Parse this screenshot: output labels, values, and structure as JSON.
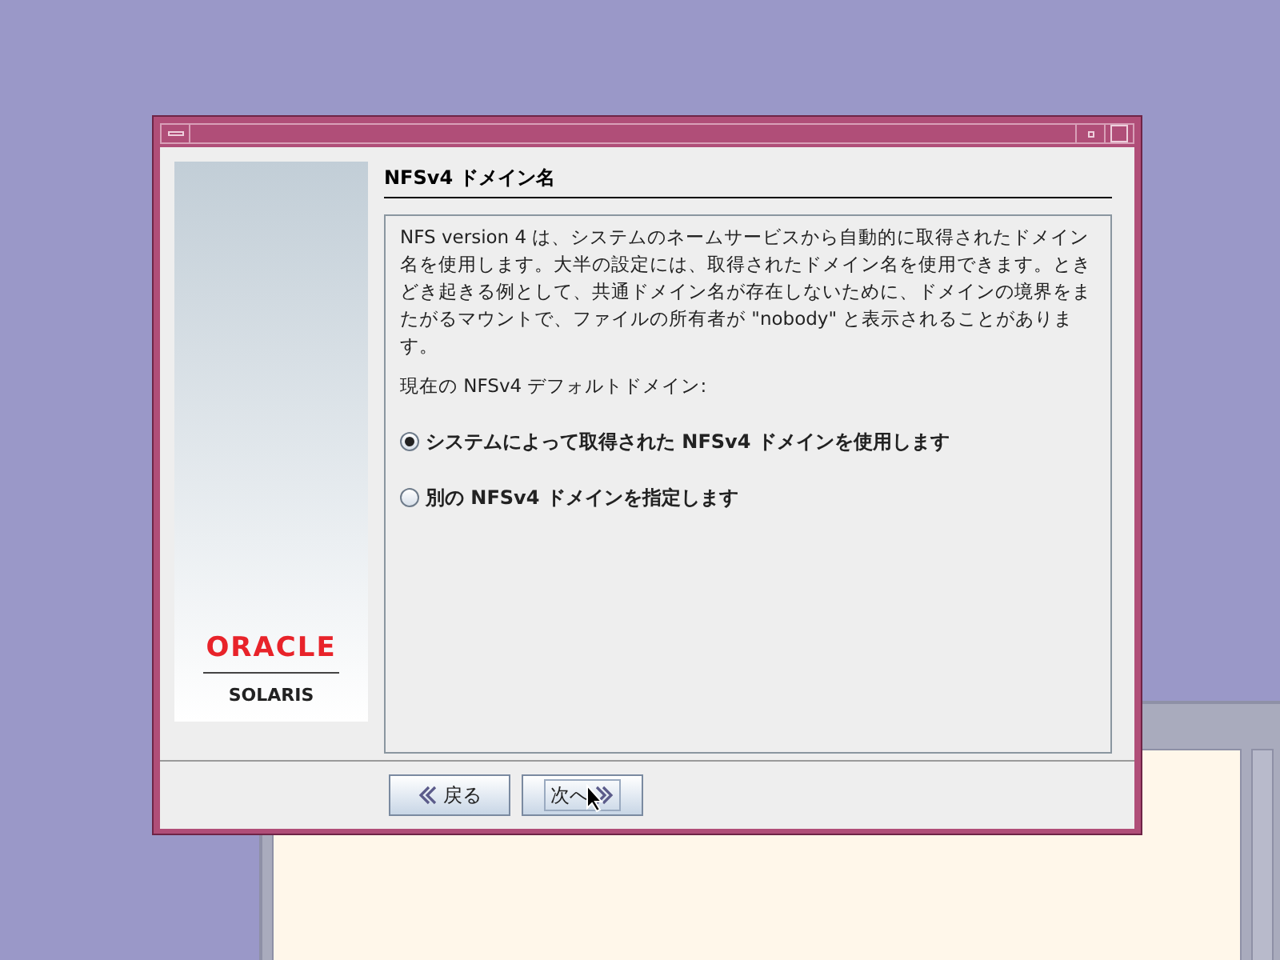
{
  "dialog": {
    "heading": "NFSv4 ドメイン名",
    "description": "NFS version 4 は、システムのネームサービスから自動的に取得されたドメイン名を使用します。大半の設定には、取得されたドメイン名を使用できます。ときどき起きる例として、共通ドメイン名が存在しないために、ドメインの境界をまたがるマウントで、ファイルの所有者が \"nobody\" と表示されることがあります。",
    "current_label": "現在の NFSv4 デフォルトドメイン:",
    "options": [
      {
        "label": "システムによって取得された NFSv4 ドメインを使用します",
        "selected": true
      },
      {
        "label": "別の NFSv4 ドメインを指定します",
        "selected": false
      }
    ],
    "logo": {
      "brand": "ORACLE",
      "product": "SOLARIS"
    },
    "buttons": [
      {
        "label": "戻る",
        "kind": "back",
        "focused": false
      },
      {
        "label": "次へ",
        "kind": "next",
        "focused": true
      }
    ]
  }
}
